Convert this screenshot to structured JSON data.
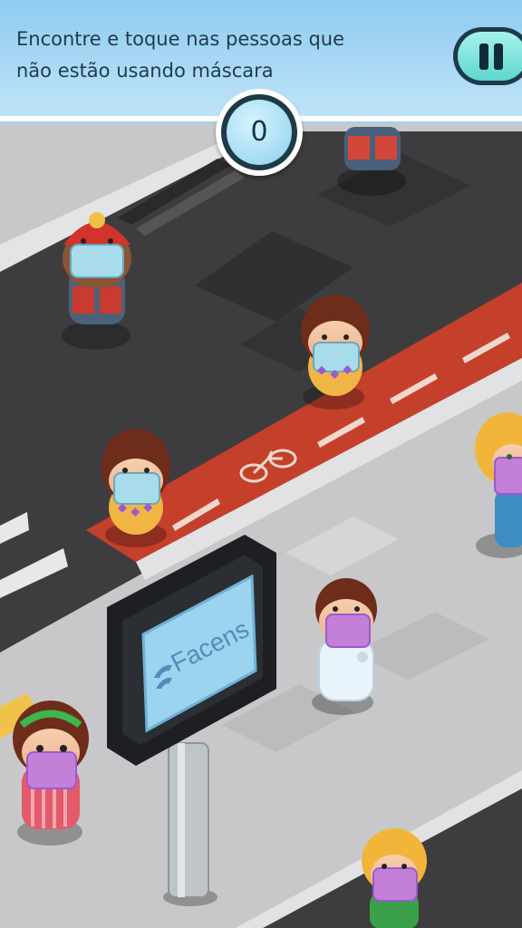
{
  "hud": {
    "instruction_line1": "Encontre e toque nas pessoas que",
    "instruction_line2": "não estão usando máscara",
    "score": "0"
  },
  "billboard": {
    "brand": "Facens"
  },
  "characters": [
    {
      "id": "firefighter",
      "mask": "surgical"
    },
    {
      "id": "girl-road",
      "mask": "surgical"
    },
    {
      "id": "girl-bikelane",
      "mask": "surgical"
    },
    {
      "id": "blonde-right",
      "mask": "cloth"
    },
    {
      "id": "doctor",
      "mask": "cloth"
    },
    {
      "id": "girl-headband",
      "mask": "cloth"
    },
    {
      "id": "blonde-bottom",
      "mask": "cloth"
    },
    {
      "id": "partial-top",
      "mask": "unknown"
    }
  ],
  "colors": {
    "asphalt": "#3e3e40",
    "sidewalk": "#c7c7c9",
    "bike_lane": "#c7402a",
    "hud": "#9fd4f2",
    "accent": "#5fd6cf"
  }
}
